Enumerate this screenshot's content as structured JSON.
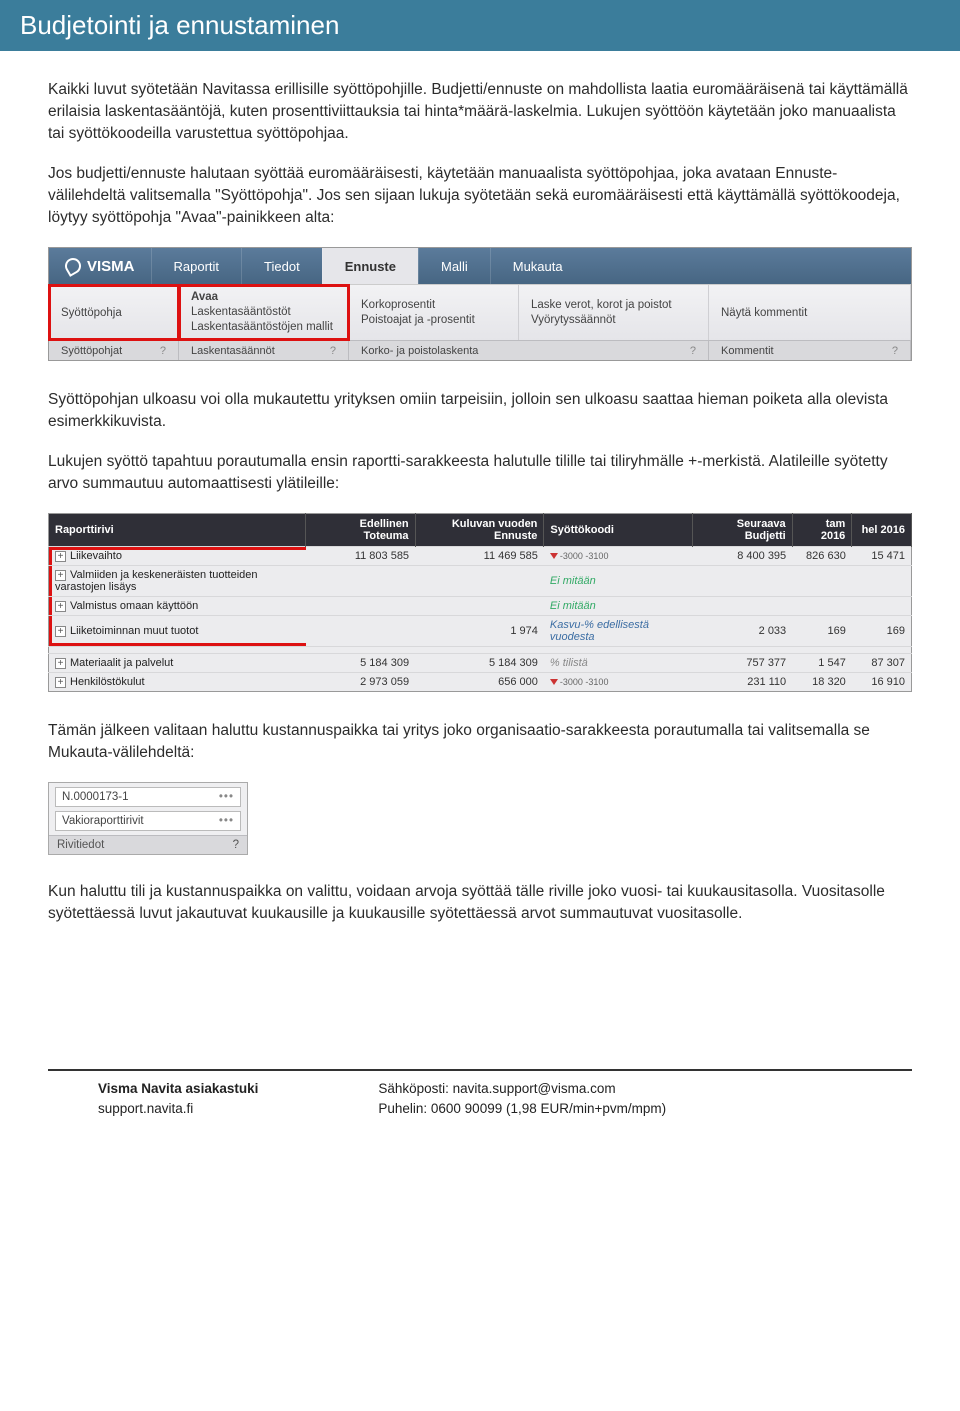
{
  "title": "Budjetointi ja ennustaminen",
  "para1": "Kaikki luvut syötetään Navitassa erillisille syöttöpohjille. Budjetti/ennuste on mahdollista laatia euromääräisenä tai käyttämällä erilaisia laskentasääntöjä, kuten prosenttiviittauksia tai hinta*määrä-laskelmia. Lukujen syöttöön käytetään joko manuaalista tai syöttökoodeilla varustettua syöttöpohjaa.",
  "para2": "Jos budjetti/ennuste halutaan syöttää euromääräisesti, käytetään manuaalista syöttöpohjaa, joka avataan Ennuste-välilehdeltä valitsemalla \"Syöttöpohja\". Jos sen sijaan lukuja syötetään sekä euromääräisesti että käyttämällä syöttökoodeja, löytyy syöttöpohja \"Avaa\"-painikkeen alta:",
  "para3": "Syöttöpohjan ulkoasu voi olla mukautettu yrityksen omiin tarpeisiin, jolloin sen ulkoasu saattaa hieman poiketa alla olevista esimerkkikuvista.",
  "para4": "Lukujen syöttö tapahtuu porautumalla ensin raportti-sarakkeesta halutulle tilille tai tiliryhmälle +-merkistä. Alatileille syötetty arvo summautuu automaattisesti ylätileille:",
  "para5": "Tämän jälkeen valitaan haluttu kustannuspaikka tai yritys joko organisaatio-sarakkeesta porautumalla tai valitsemalla se Mukauta-välilehdeltä:",
  "para6": "Kun haluttu tili ja kustannuspaikka on valittu, voidaan arvoja syöttää tälle riville joko vuosi- tai kuukausitasolla. Vuositasolle syötettäessä luvut jakautuvat kuukausille ja kuukausille syötettäessä arvot summautuvat vuositasolle.",
  "shot1": {
    "brand": "VISMA",
    "tabs": [
      "Raportit",
      "Tiedot",
      "Ennuste",
      "Malli",
      "Mukauta"
    ],
    "activeTab": "Ennuste",
    "group1": {
      "title": "Syöttöpohja"
    },
    "group2": {
      "a": "Avaa",
      "b": "Laskentasääntöstöt",
      "c": "Laskentasääntöstöjen mallit"
    },
    "group3": {
      "a": "Korkoprosentit",
      "b": "Poistoajat ja -prosentit"
    },
    "group4": {
      "a": "Laske verot, korot ja poistot",
      "b": "Vyörytyssäännöt"
    },
    "group5": {
      "a": "Näytä kommentit"
    },
    "footers": [
      "Syöttöpohjat",
      "Laskentasäännöt",
      "Korko- ja poistolaskenta",
      "Kommentit"
    ]
  },
  "shot2": {
    "headers": [
      "Raporttirivi",
      "Edellinen Toteuma",
      "Kuluvan vuoden Ennuste",
      "Syöttökoodi",
      "Seuraava Budjetti",
      "tam 2016",
      "hel 2016"
    ],
    "rows": [
      {
        "label": "Liikevaihto",
        "c1": "11 803 585",
        "c2": "11 469 585",
        "code": "-3000 -3100",
        "codeType": "arrow",
        "c4": "8 400 395",
        "c5": "826 630",
        "c6": "15 471"
      },
      {
        "label": "Valmiiden ja keskeneräisten tuotteiden varastojen lisäys",
        "c1": "",
        "c2": "",
        "code": "Ei mitään",
        "codeType": "green",
        "c4": "",
        "c5": "",
        "c6": ""
      },
      {
        "label": "Valmistus omaan käyttöön",
        "c1": "",
        "c2": "",
        "code": "Ei mitään",
        "codeType": "green",
        "c4": "",
        "c5": "",
        "c6": ""
      },
      {
        "label": "Liiketoiminnan muut tuotot",
        "c1": "",
        "c2": "1 974",
        "code": "Kasvu-% edellisestä vuodesta",
        "codeType": "blue",
        "c4": "2 033",
        "c5": "169",
        "c6": "169"
      },
      {
        "label": "",
        "c1": "",
        "c2": "",
        "code": "",
        "codeType": "",
        "c4": "",
        "c5": "",
        "c6": ""
      },
      {
        "label": "Materiaalit ja palvelut",
        "c1": "5 184 309",
        "c2": "5 184 309",
        "code": "% tilistä",
        "codeType": "gray",
        "c4": "757 377",
        "c5": "1 547",
        "c6": "87 307"
      },
      {
        "label": "Henkilöstökulut",
        "c1": "2 973 059",
        "c2": "656 000",
        "code": "-3000 -3100",
        "codeType": "arrow",
        "c4": "231 110",
        "c5": "18 320",
        "c6": "16 910"
      }
    ]
  },
  "shot3": {
    "row1": "N.0000173-1",
    "row2": "Vakioraporttirivit",
    "foot": "Rivitiedot"
  },
  "footer": {
    "l1": "Visma Navita asiakastuki",
    "l2": "support.navita.fi",
    "r1": "Sähköposti: navita.support@visma.com",
    "r2": "Puhelin: 0600 90099 (1,98 EUR/min+pvm/mpm)"
  }
}
